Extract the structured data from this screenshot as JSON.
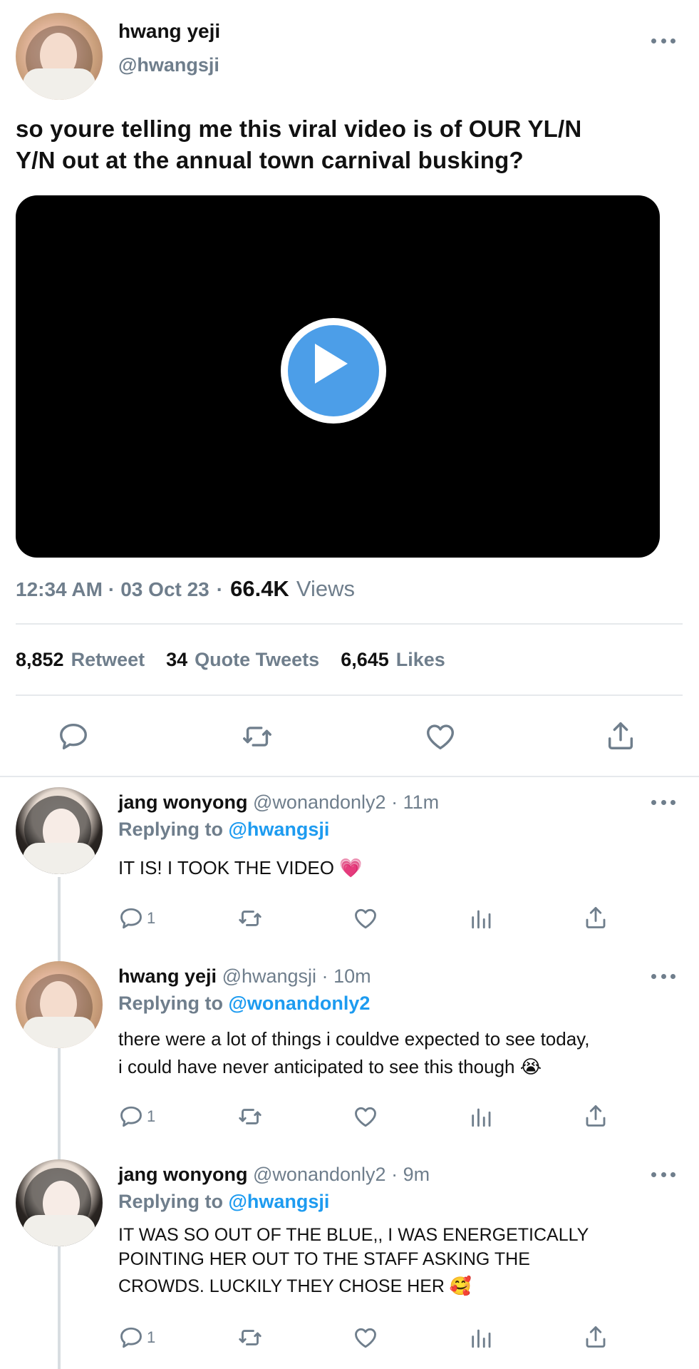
{
  "main_tweet": {
    "name": "hwang yeji",
    "handle": "@hwangsji",
    "text_line1": "so youre telling me this viral video is of OUR YL/N",
    "text_line2": "Y/N out at the annual town carnival busking?",
    "time": "12:34 AM",
    "date": "03 Oct 23",
    "views_count": "66.4K",
    "views_label": "Views",
    "retweets_count": "8,852",
    "retweets_label": "Retweet",
    "quotes_count": "34",
    "quotes_label": "Quote Tweets",
    "likes_count": "6,645",
    "likes_label": "Likes"
  },
  "replies": [
    {
      "name": "jang wonyong",
      "handle": "@wonandonly2",
      "time": "11m",
      "replying_label": "Replying to",
      "replying_to": "@hwangsji",
      "text_line1": "IT IS! I TOOK THE VIDEO 💗",
      "reply_count": "1"
    },
    {
      "name": "hwang yeji",
      "handle": "@hwangsji",
      "time": "10m",
      "replying_label": "Replying to",
      "replying_to": "@wonandonly2",
      "text_line1": "there were a lot of things i couldve expected to see today,",
      "text_line2": "i could have never anticipated to see this though 😭",
      "reply_count": "1"
    },
    {
      "name": "jang wonyong",
      "handle": "@wonandonly2",
      "time": "9m",
      "replying_label": "Replying to",
      "replying_to": "@hwangsji",
      "text_line1": "IT WAS SO OUT OF THE BLUE,, I WAS ENERGETICALLY",
      "text_line2": "POINTING HER OUT TO THE STAFF ASKING THE",
      "text_line3": "CROWDS. LUCKILY THEY CHOSE HER 🥰",
      "reply_count": "1"
    }
  ],
  "separator": "·",
  "icons": [
    "more-icon",
    "play-icon",
    "reply-icon",
    "retweet-icon",
    "like-icon",
    "share-icon",
    "analytics-icon"
  ],
  "colors": {
    "accent": "#1d9bf0",
    "secondary_text": "#6f7e8c",
    "play_button": "#4c9ee8"
  }
}
